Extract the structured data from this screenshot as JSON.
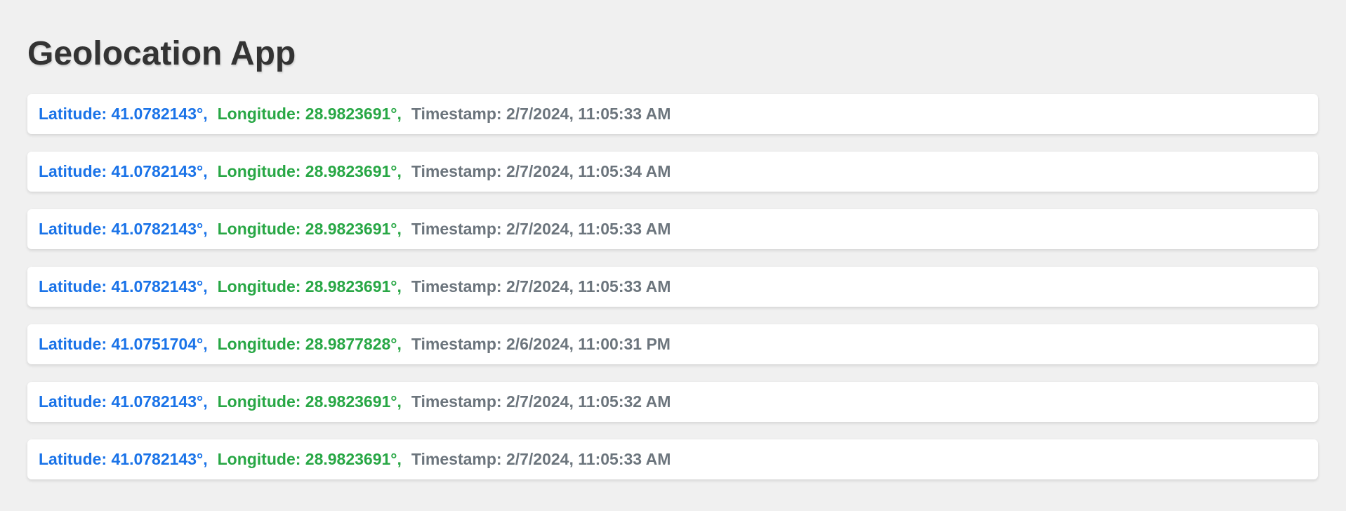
{
  "app": {
    "title": "Geolocation App"
  },
  "colors": {
    "latitude": "#1a73e8",
    "longitude": "#28a745",
    "timestamp": "#6c757d",
    "heading": "#333333",
    "background": "#f0f0f0"
  },
  "entries": [
    {
      "latitude": "Latitude: 41.0782143°,",
      "longitude": "Longitude: 28.9823691°,",
      "timestamp": "Timestamp: 2/7/2024, 11:05:33 AM"
    },
    {
      "latitude": "Latitude: 41.0782143°,",
      "longitude": "Longitude: 28.9823691°,",
      "timestamp": "Timestamp: 2/7/2024, 11:05:34 AM"
    },
    {
      "latitude": "Latitude: 41.0782143°,",
      "longitude": "Longitude: 28.9823691°,",
      "timestamp": "Timestamp: 2/7/2024, 11:05:33 AM"
    },
    {
      "latitude": "Latitude: 41.0782143°,",
      "longitude": "Longitude: 28.9823691°,",
      "timestamp": "Timestamp: 2/7/2024, 11:05:33 AM"
    },
    {
      "latitude": "Latitude: 41.0751704°,",
      "longitude": "Longitude: 28.9877828°,",
      "timestamp": "Timestamp: 2/6/2024, 11:00:31 PM"
    },
    {
      "latitude": "Latitude: 41.0782143°,",
      "longitude": "Longitude: 28.9823691°,",
      "timestamp": "Timestamp: 2/7/2024, 11:05:32 AM"
    },
    {
      "latitude": "Latitude: 41.0782143°,",
      "longitude": "Longitude: 28.9823691°,",
      "timestamp": "Timestamp: 2/7/2024, 11:05:33 AM"
    }
  ]
}
